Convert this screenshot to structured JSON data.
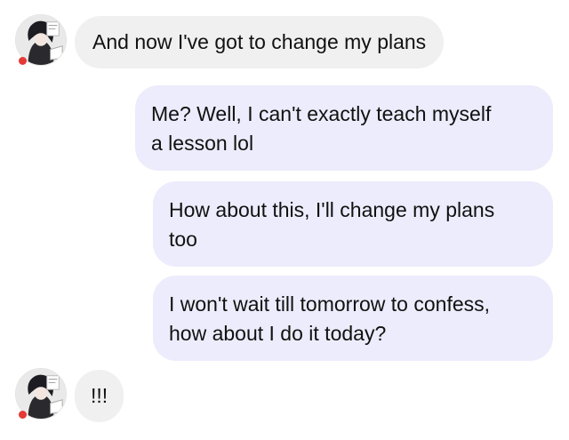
{
  "conversation": {
    "messages": [
      {
        "sender": "other",
        "text": "And now I've got to change my plans"
      },
      {
        "sender": "me",
        "text": "Me? Well, I can't exactly teach myself\na lesson lol"
      },
      {
        "sender": "me",
        "text": "How about this, I'll change my plans\ntoo"
      },
      {
        "sender": "me",
        "text": "I won't wait till tomorrow to confess,\nhow about I do it today?"
      },
      {
        "sender": "other",
        "text": "!!!"
      }
    ]
  },
  "colors": {
    "incoming_bubble": "#f0f0f0",
    "outgoing_bubble": "#ececfc",
    "unread_dot": "#e53935",
    "text": "#111111"
  },
  "icons": {
    "avatar": "contact-avatar-icon",
    "status_dot": "unread-dot-icon"
  }
}
